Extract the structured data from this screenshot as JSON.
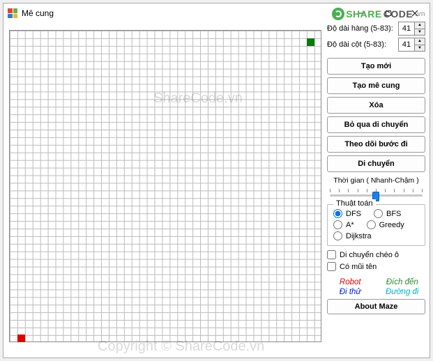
{
  "window": {
    "title": "Mê cung"
  },
  "logo": {
    "share": "SHARE",
    "code": "CODE",
    "suffix": ".vn"
  },
  "inputs": {
    "rows_label": "Độ dài hàng (5-83):",
    "rows_value": "41",
    "cols_label": "Độ dài cột (5-83):",
    "cols_value": "41"
  },
  "buttons": {
    "new": "Tạo mới",
    "generate": "Tạo mê cung",
    "clear": "Xóa",
    "skip": "Bỏ qua di chuyển",
    "trace": "Theo dõi bước đi",
    "move": "Di chuyển",
    "about": "About Maze"
  },
  "speed": {
    "label": "Thời gian ( Nhanh-Chậm )"
  },
  "algo": {
    "legend": "Thuật toán",
    "dfs": "DFS",
    "bfs": "BFS",
    "astar": "A*",
    "greedy": "Greedy",
    "dijkstra": "Dijkstra",
    "selected": "dfs"
  },
  "options": {
    "diagonal": "Di chuyển chéo ô",
    "arrows": "Có mũi tên"
  },
  "legend_keys": {
    "robot": "Robot",
    "dest": "Đích đến",
    "tried": "Đi thử",
    "path": "Đường đi"
  },
  "grid": {
    "rows": 41,
    "cols": 41,
    "start": {
      "row": 40,
      "col": 1
    },
    "end": {
      "row": 1,
      "col": 39
    }
  },
  "watermarks": {
    "wm1": "ShareCode.vn",
    "wm2": "Copyright © ShareCode.vn"
  }
}
